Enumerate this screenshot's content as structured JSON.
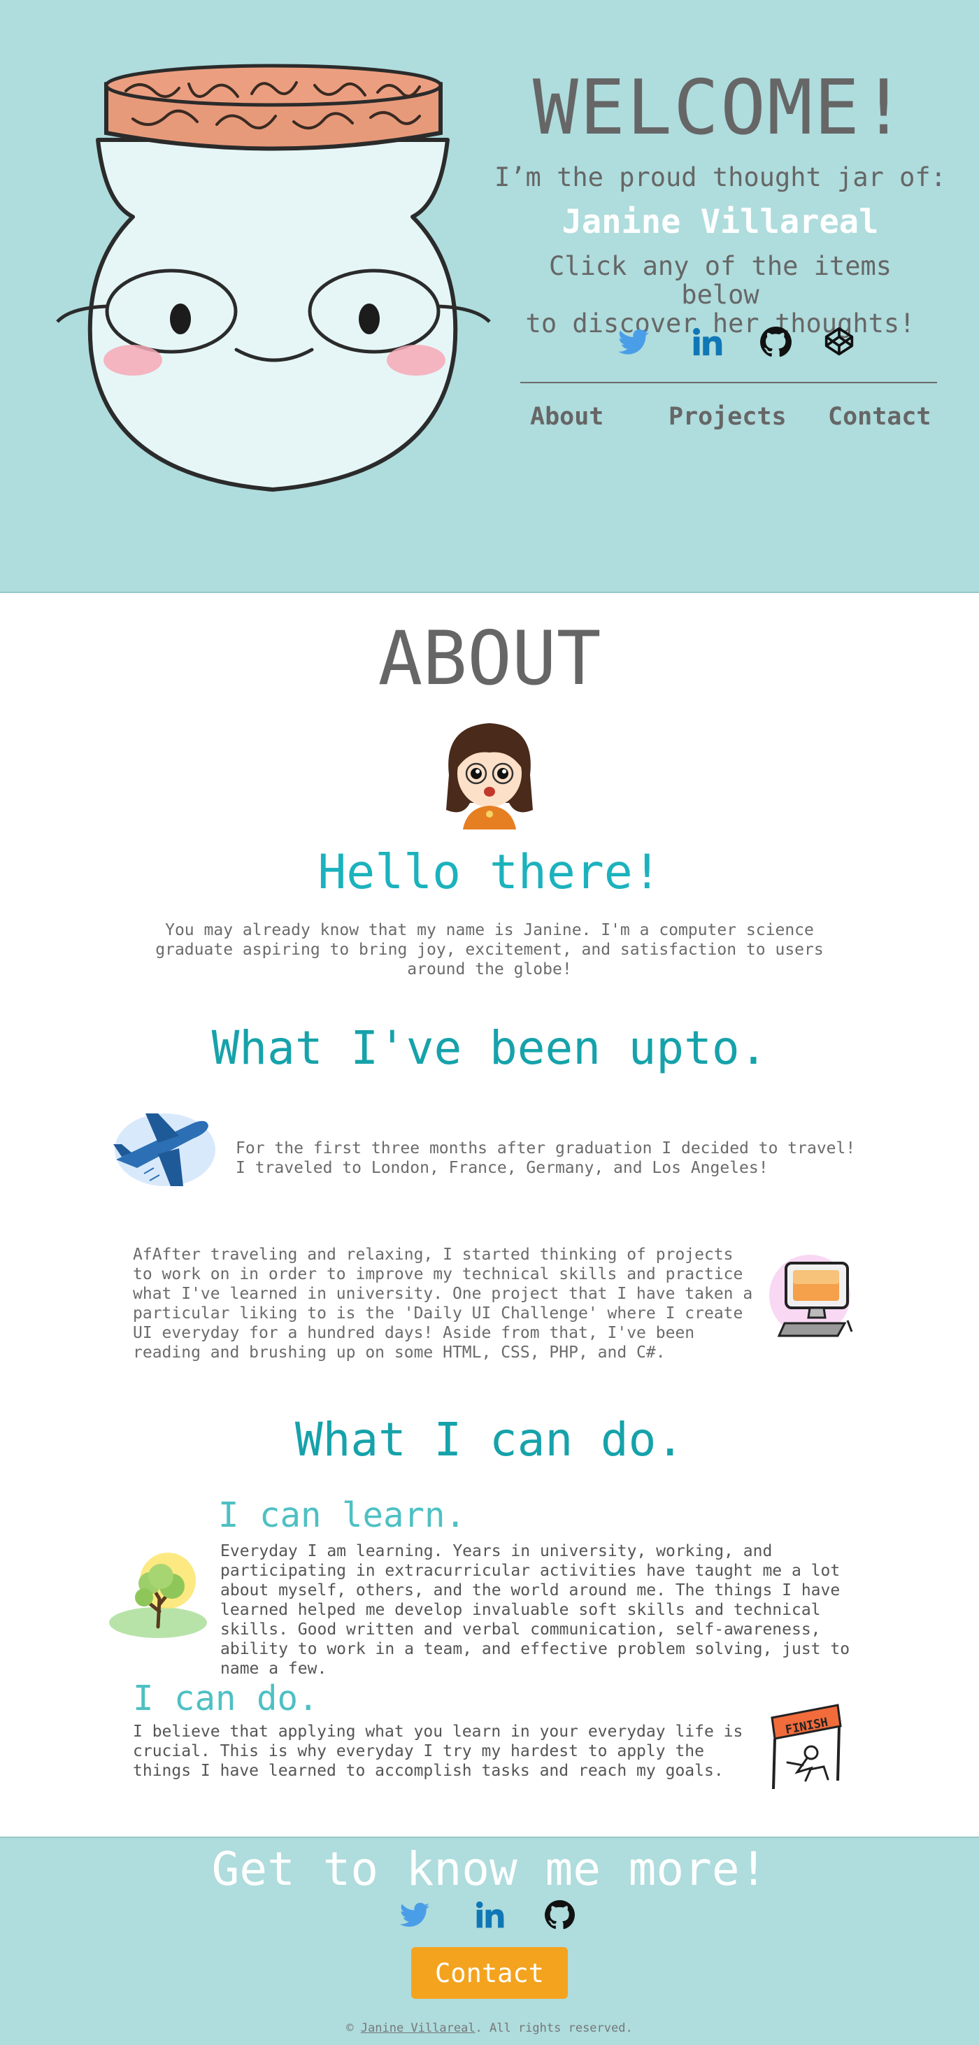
{
  "hero": {
    "welcome": "WELCOME!",
    "proud": "I’m the proud thought jar of:",
    "name": "Janine Villareal",
    "click_line1": "Click any of the items below",
    "click_line2": "to discover her thoughts!",
    "social": [
      "twitter-icon",
      "linkedin-icon",
      "github-icon",
      "codepen-icon"
    ],
    "nav": [
      "About",
      "Projects",
      "Contact"
    ]
  },
  "about": {
    "title": "ABOUT",
    "hello": "Hello there!",
    "intro": "You may already know that my name is Janine. I'm a computer science graduate aspiring to bring joy, excitement, and satisfaction to users around the globe!"
  },
  "upto": {
    "title": "What I've been upto.",
    "travel": "For the first three months after graduation I decided to travel! I traveled to London, France, Germany, and Los Angeles!",
    "projects": "AfAfter traveling and relaxing, I started thinking of projects to work on in order to improve my technical skills and practice what I've learned in university. One project that I have taken a particular liking to is the 'Daily UI Challenge' where I create UI everyday for a hundred days! Aside from that, I've been reading and brushing up on some HTML, CSS, PHP, and C#."
  },
  "cando": {
    "title": "What I can do.",
    "learn_head": "I can learn.",
    "learn_text": "Everyday I am learning. Years in university, working, and participating in extracurricular activities have taught me a lot about myself, others, and the world around me. The things I have learned helped me develop invaluable soft skills and technical skills. Good written and verbal communication, self-awareness, ability to work in a team, and effective problem solving, just to name a few.",
    "do_head": "I can do.",
    "do_text": "I believe that applying what you learn in your everyday life is crucial. This is why everyday I try my hardest to apply the things I have learned to accomplish tasks and reach my goals.",
    "finish_flag": "FINISH"
  },
  "footer": {
    "heading": "Get to know me more!",
    "social": [
      "twitter-icon",
      "linkedin-icon",
      "github-icon"
    ],
    "contact_button": "Contact",
    "copyright_prefix": "©",
    "copyright_name": "Janine Villareal",
    "copyright_suffix": ". All rights reserved."
  },
  "colors": {
    "hero_bg": "#afdcdd",
    "heading_teal": "#16a2aa",
    "subheading_teal": "#4ec0c3",
    "button_orange": "#f4a31f",
    "twitter_blue": "#4a9ee8",
    "linkedin_blue": "#0f77b5"
  }
}
